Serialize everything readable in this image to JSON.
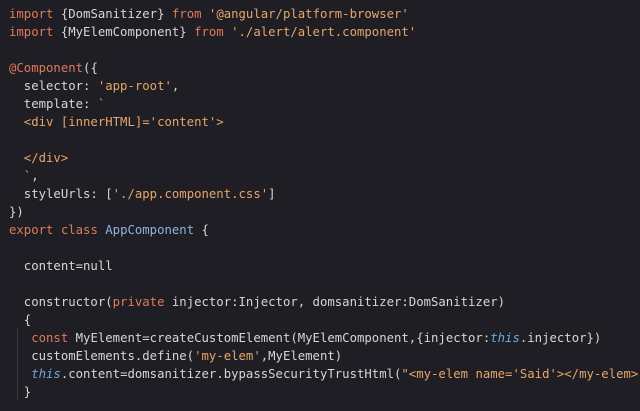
{
  "editor": {
    "background": "#1e1e24",
    "lines": [
      [
        {
          "t": "import",
          "c": "kw"
        },
        {
          "t": " {DomSanitizer} ",
          "c": "id"
        },
        {
          "t": "from",
          "c": "kw"
        },
        {
          "t": " '@angular/platform-browser'",
          "c": "str"
        }
      ],
      [
        {
          "t": "import",
          "c": "kw"
        },
        {
          "t": " {MyElemComponent} ",
          "c": "id"
        },
        {
          "t": "from",
          "c": "kw"
        },
        {
          "t": " './alert/alert.component'",
          "c": "str"
        }
      ],
      [],
      [
        {
          "t": "@Component",
          "c": "dec"
        },
        {
          "t": "({",
          "c": "id"
        }
      ],
      [
        {
          "t": "  selector: ",
          "c": "id"
        },
        {
          "t": "'app-root'",
          "c": "str"
        },
        {
          "t": ",",
          "c": "id"
        }
      ],
      [
        {
          "t": "  template: ",
          "c": "id"
        },
        {
          "t": "`",
          "c": "str"
        }
      ],
      [
        {
          "t": "  <div [innerHTML]='content'>",
          "c": "str"
        }
      ],
      [],
      [
        {
          "t": "  </div>",
          "c": "str"
        }
      ],
      [
        {
          "t": "  `",
          "c": "str"
        },
        {
          "t": ",",
          "c": "id"
        }
      ],
      [
        {
          "t": "  styleUrls: [",
          "c": "id"
        },
        {
          "t": "'./app.component.css'",
          "c": "str"
        },
        {
          "t": "]",
          "c": "id"
        }
      ],
      [
        {
          "t": "})",
          "c": "id"
        }
      ],
      [
        {
          "t": "export",
          "c": "kw"
        },
        {
          "t": " ",
          "c": "id"
        },
        {
          "t": "class",
          "c": "kw"
        },
        {
          "t": " ",
          "c": "id"
        },
        {
          "t": "AppComponent",
          "c": "cls"
        },
        {
          "t": " {",
          "c": "id"
        }
      ],
      [],
      [
        {
          "t": "  content=null",
          "c": "id"
        }
      ],
      [],
      [
        {
          "t": "  constructor(",
          "c": "id"
        },
        {
          "t": "private",
          "c": "kw"
        },
        {
          "t": " injector:Injector, domsanitizer:DomSanitizer)",
          "c": "id"
        }
      ],
      [
        {
          "t": "  {",
          "c": "id"
        }
      ],
      [
        {
          "t": "   ",
          "c": "id"
        },
        {
          "t": "const",
          "c": "kw"
        },
        {
          "t": " MyElement=createCustomElement(MyElemComponent,{injector:",
          "c": "id"
        },
        {
          "t": "this",
          "c": "this"
        },
        {
          "t": ".injector})",
          "c": "id"
        }
      ],
      [
        {
          "t": "   customElements.define(",
          "c": "id"
        },
        {
          "t": "'my-elem'",
          "c": "str"
        },
        {
          "t": ",MyElement)",
          "c": "id"
        }
      ],
      [
        {
          "t": "   ",
          "c": "id"
        },
        {
          "t": "this",
          "c": "this"
        },
        {
          "t": ".content=domsanitizer.bypassSecurityTrustHtml(",
          "c": "id"
        },
        {
          "t": "\"<my-elem name='Said'></my-elem>\"",
          "c": "str"
        },
        {
          "t": ")",
          "c": "id"
        }
      ],
      [
        {
          "t": "  }",
          "c": "id"
        }
      ]
    ]
  }
}
